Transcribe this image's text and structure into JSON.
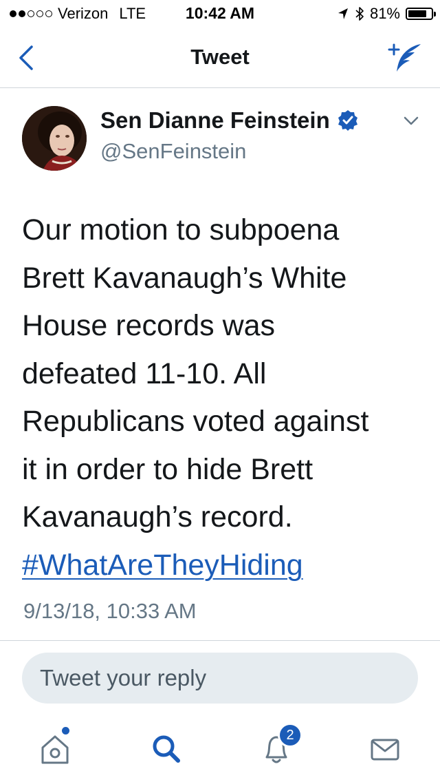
{
  "status_bar": {
    "carrier": "Verizon",
    "network": "LTE",
    "time": "10:42 AM",
    "battery": "81%",
    "battery_level": 0.81,
    "signal_bars_filled": 2,
    "signal_bars_total": 5
  },
  "nav": {
    "title": "Tweet",
    "back_icon": "chevron-left-icon",
    "compose_icon": "compose-tweet-icon"
  },
  "tweet": {
    "author_name": "Sen Dianne Feinstein",
    "verified": true,
    "handle": "@SenFeinstein",
    "text_lines": [
      "Our motion to subpoena",
      "Brett Kavanaugh’s White",
      "House records was",
      "defeated 11-10. All",
      "Republicans voted against",
      "it in order to hide Brett",
      "Kavanaugh’s record."
    ],
    "hashtag": "#WhatAreTheyHiding",
    "timestamp": "9/13/18, 10:33 AM"
  },
  "reply": {
    "placeholder": "Tweet your reply"
  },
  "tab_bar": {
    "items": [
      {
        "name": "home",
        "icon": "home-icon",
        "has_dot": true
      },
      {
        "name": "search",
        "icon": "search-icon",
        "active": true
      },
      {
        "name": "notifications",
        "icon": "bell-icon",
        "badge": "2"
      },
      {
        "name": "messages",
        "icon": "envelope-icon"
      }
    ]
  },
  "colors": {
    "accent": "#1b5cb8",
    "text": "#14171a",
    "secondary_text": "#657786",
    "reply_bg": "#e6ecf0",
    "divider": "#cfd5da"
  }
}
